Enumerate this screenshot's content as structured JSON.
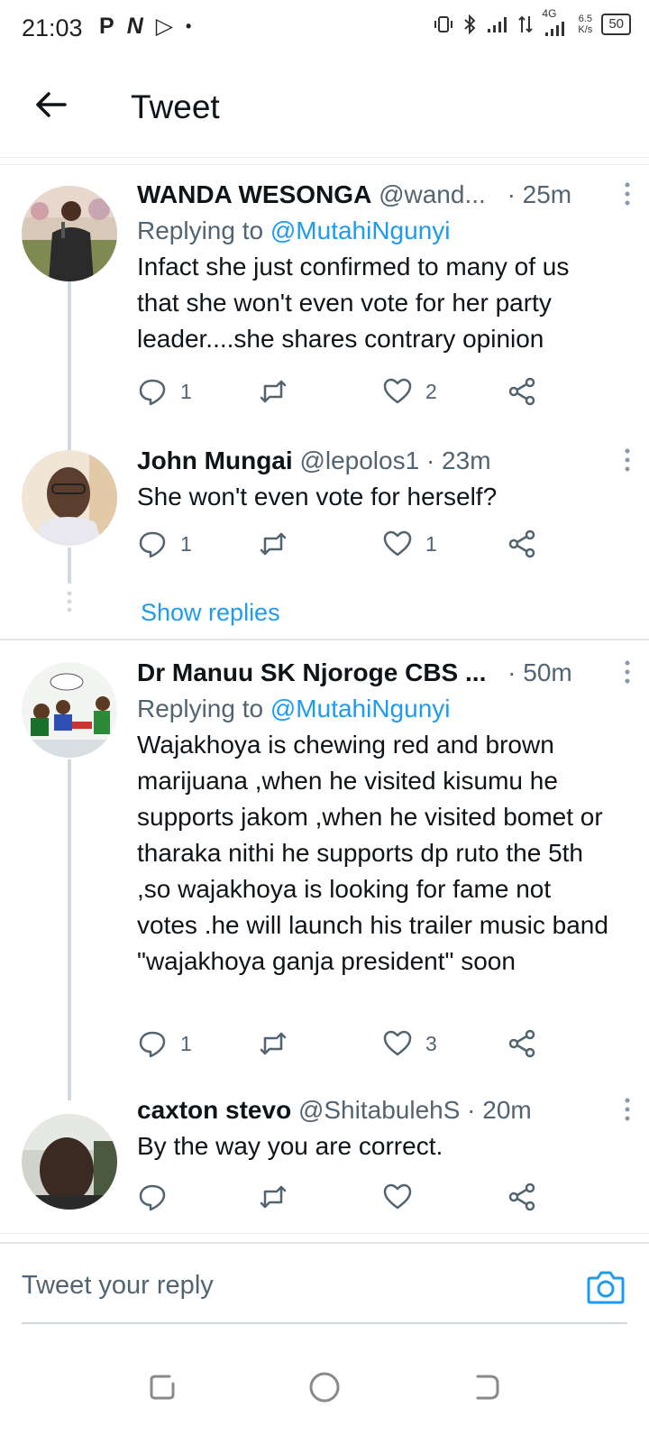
{
  "status_bar": {
    "time": "21:03",
    "left_icons": [
      "P",
      "N",
      "▷",
      "•"
    ],
    "network": "4G",
    "speed_value": "6.5",
    "speed_unit": "K/s",
    "battery": "50"
  },
  "header": {
    "title": "Tweet"
  },
  "tweets": [
    {
      "name": "WANDA WESONGA",
      "handle": "@wand...",
      "time": "· 25m",
      "replying_label": "Replying to",
      "replying_to": "@MutahiNgunyi",
      "text": "Infact she just confirmed to many of us that she won't  even vote for her party leader....she shares contrary opinion",
      "replies": "1",
      "retweets": "",
      "likes": "2"
    },
    {
      "name": "John Mungai",
      "handle": "@lepolos1",
      "time": "· 23m",
      "text": "She won't even vote for herself?",
      "replies": "1",
      "retweets": "",
      "likes": "1"
    },
    {
      "name": "Dr Manuu SK Njoroge CBS ...",
      "handle": "",
      "time": "· 50m",
      "replying_label": "Replying to",
      "replying_to": "@MutahiNgunyi",
      "text": "Wajakhoya is chewing red and brown marijuana ,when he visited kisumu he supports jakom ,when he visited bomet or tharaka nithi he supports dp ruto the 5th ,so wajakhoya is looking for fame not votes .he will launch his trailer music band \"wajakhoya ganja president\" soon",
      "replies": "1",
      "retweets": "",
      "likes": "3"
    },
    {
      "name": "caxton stevo",
      "handle": "@ShitabulehS",
      "time": "· 20m",
      "text": "By the way you are correct.",
      "replies": "",
      "retweets": "",
      "likes": ""
    }
  ],
  "show_replies_label": "Show replies",
  "reply_box": {
    "placeholder": "Tweet your reply"
  },
  "colors": {
    "accent": "#1d9bf0",
    "secondary_text": "#536471",
    "thread_line": "#cfd9de"
  }
}
